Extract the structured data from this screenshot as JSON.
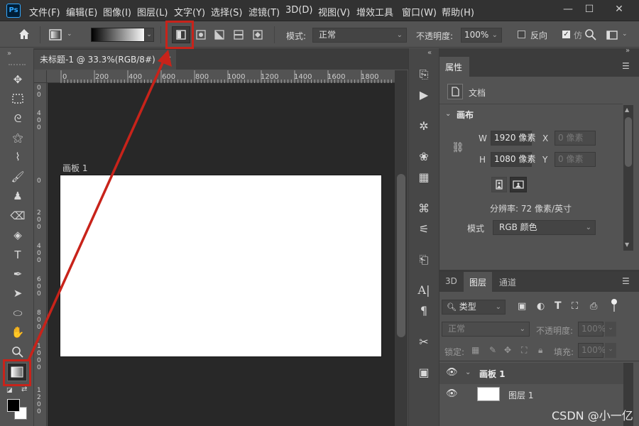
{
  "app": {
    "logo": "Ps"
  },
  "menu": [
    "文件(F)",
    "编辑(E)",
    "图像(I)",
    "图层(L)",
    "文字(Y)",
    "选择(S)",
    "滤镜(T)",
    "3D(D)",
    "视图(V)",
    "增效工具",
    "窗口(W)",
    "帮助(H)"
  ],
  "window_controls": {
    "minimize": "—",
    "maximize": "☐",
    "close": "✕"
  },
  "options": {
    "mode_label": "模式:",
    "mode_value": "正常",
    "opacity_label": "不透明度:",
    "opacity_value": "100%",
    "reverse_label": "反向",
    "dither_label": "仿"
  },
  "document": {
    "tab_title": "未标题-1 @ 33.3%(RGB/8#)",
    "close": "×",
    "artboard_label": "画板 1"
  },
  "ruler": {
    "h_ticks": [
      "0",
      "200",
      "400",
      "600",
      "800",
      "1000",
      "1200",
      "1400",
      "1600",
      "1800"
    ],
    "v_ticks": [
      "0\n0",
      "4\n0\n0",
      "0",
      "2\n0\n0",
      "4\n0\n0",
      "6\n0\n0",
      "8\n0\n0",
      "1\n0\n0\n0",
      "1\n2\n0\n0"
    ]
  },
  "properties": {
    "tab": "属性",
    "doc_label": "文档",
    "section_title": "画布",
    "w_label": "W",
    "w_value": "1920 像素",
    "h_label": "H",
    "h_value": "1080 像素",
    "x_label": "X",
    "x_value": "0 像素",
    "y_label": "Y",
    "y_value": "0 像素",
    "resolution": "分辨率: 72 像素/英寸",
    "mode_label": "模式",
    "mode_value": "RGB 颜色"
  },
  "layers": {
    "tabs": [
      "3D",
      "图层",
      "通道"
    ],
    "active_tab": "图层",
    "filter_label": "类型",
    "blend_value": "正常",
    "opacity_label": "不透明度:",
    "opacity_value": "100%",
    "lock_label": "锁定:",
    "fill_label": "填充:",
    "fill_value": "100%",
    "items": [
      {
        "name": "画板 1",
        "type": "artboard"
      },
      {
        "name": "图层 1",
        "type": "layer"
      }
    ]
  },
  "watermark": "CSDN @小一亿",
  "colors": {
    "annotation_red": "#c8231a",
    "accent_blue": "#31a8ff"
  }
}
